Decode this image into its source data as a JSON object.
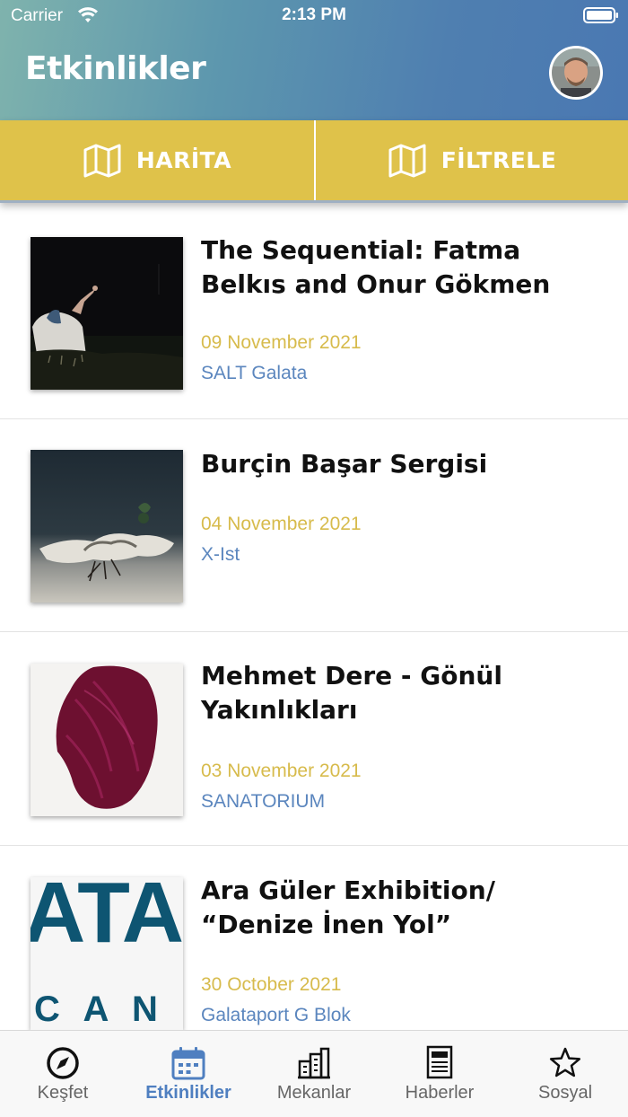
{
  "status_bar": {
    "carrier": "Carrier",
    "time": "2:13 PM"
  },
  "header": {
    "title": "Etkinlikler"
  },
  "actions": {
    "map_label": "HARİTA",
    "filter_label": "FİLTRELE"
  },
  "events": [
    {
      "title": "The Sequential: Fatma Belkıs and Onur Gökmen",
      "date": "09 November 2021",
      "venue": "SALT Galata"
    },
    {
      "title": "Burçin Başar Sergisi",
      "date": "04 November 2021",
      "venue": "X-Ist"
    },
    {
      "title": "Mehmet Dere - Gönül Yakınlıkları",
      "date": "03 November 2021",
      "venue": "SANATORIUM"
    },
    {
      "title": "Ara Güler Exhibition/ “Denize İnen Yol”",
      "date": "30 October 2021",
      "venue": "Galataport G Blok"
    }
  ],
  "thumb4_text": {
    "top": "ATAF",
    "bottom": "C A N B"
  },
  "tabs": [
    {
      "label": "Keşfet",
      "icon": "compass-icon"
    },
    {
      "label": "Etkinlikler",
      "icon": "calendar-icon",
      "active": true
    },
    {
      "label": "Mekanlar",
      "icon": "buildings-icon"
    },
    {
      "label": "Haberler",
      "icon": "newspaper-icon"
    },
    {
      "label": "Sosyal",
      "icon": "star-icon"
    }
  ],
  "colors": {
    "accent_yellow": "#dfc24a",
    "date_yellow": "#d7bb4c",
    "venue_blue": "#5b86be",
    "active_tab": "#4f7fc0"
  }
}
